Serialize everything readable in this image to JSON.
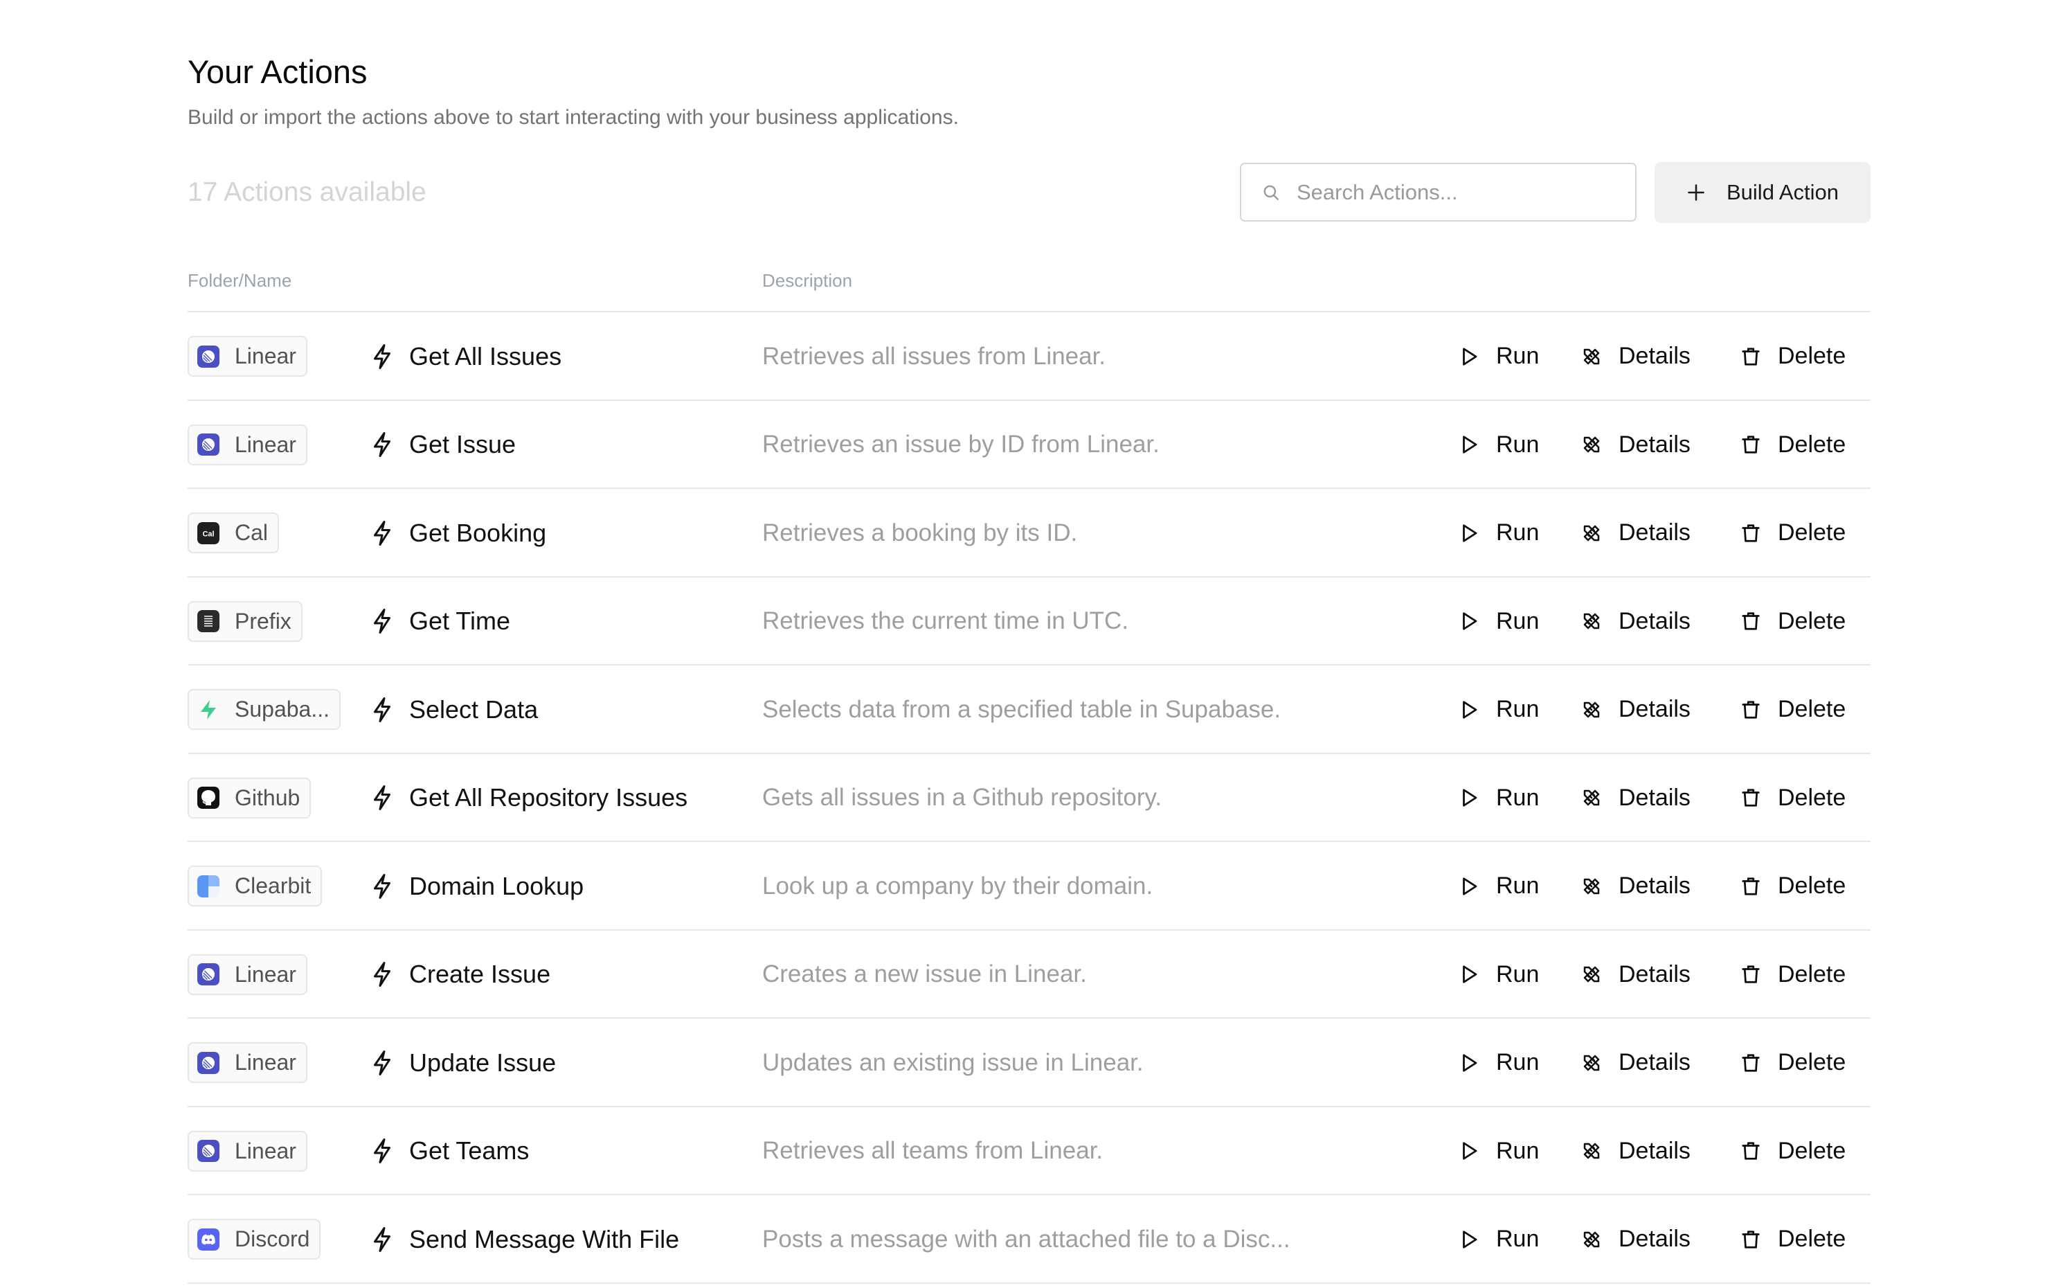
{
  "header": {
    "title": "Your Actions",
    "subtitle": "Build or import the actions above to start interacting with your business applications."
  },
  "toolbar": {
    "count_label": "17 Actions available",
    "search_placeholder": "Search Actions...",
    "search_value": "",
    "build_label": "Build Action"
  },
  "table": {
    "columns": {
      "name": "Folder/Name",
      "description": "Description"
    },
    "action_labels": {
      "run": "Run",
      "details": "Details",
      "delete": "Delete"
    },
    "rows": [
      {
        "folder": "Linear",
        "folder_icon": "linear-icon",
        "name": "Get All Issues",
        "description": "Retrieves all issues from Linear."
      },
      {
        "folder": "Linear",
        "folder_icon": "linear-icon",
        "name": "Get Issue",
        "description": "Retrieves an issue by ID from Linear."
      },
      {
        "folder": "Cal",
        "folder_icon": "cal-icon",
        "name": "Get Booking",
        "description": "Retrieves a booking by its ID."
      },
      {
        "folder": "Prefix",
        "folder_icon": "prefix-icon",
        "name": "Get Time",
        "description": "Retrieves the current time in UTC."
      },
      {
        "folder": "Supaba...",
        "folder_icon": "supabase-icon",
        "name": "Select Data",
        "description": "Selects data from a specified table in Supabase."
      },
      {
        "folder": "Github",
        "folder_icon": "github-icon",
        "name": "Get All Repository Issues",
        "description": "Gets all issues in a Github repository."
      },
      {
        "folder": "Clearbit",
        "folder_icon": "clearbit-icon",
        "name": "Domain Lookup",
        "description": "Look up a company by their domain."
      },
      {
        "folder": "Linear",
        "folder_icon": "linear-icon",
        "name": "Create Issue",
        "description": "Creates a new issue in Linear."
      },
      {
        "folder": "Linear",
        "folder_icon": "linear-icon",
        "name": "Update Issue",
        "description": "Updates an existing issue in Linear."
      },
      {
        "folder": "Linear",
        "folder_icon": "linear-icon",
        "name": "Get Teams",
        "description": "Retrieves all teams from Linear."
      },
      {
        "folder": "Discord",
        "folder_icon": "discord-icon",
        "name": "Send Message With File",
        "description": "Posts a message with an attached file to a Disc..."
      }
    ]
  },
  "colors": {
    "linear": "#4b4fc4",
    "cal": "#1f1f1f",
    "prefix": "#2b2b2b",
    "supabase": "#3ecf8e",
    "github": "#111111",
    "clearbit": "#5a96f6",
    "discord": "#5865f2"
  }
}
